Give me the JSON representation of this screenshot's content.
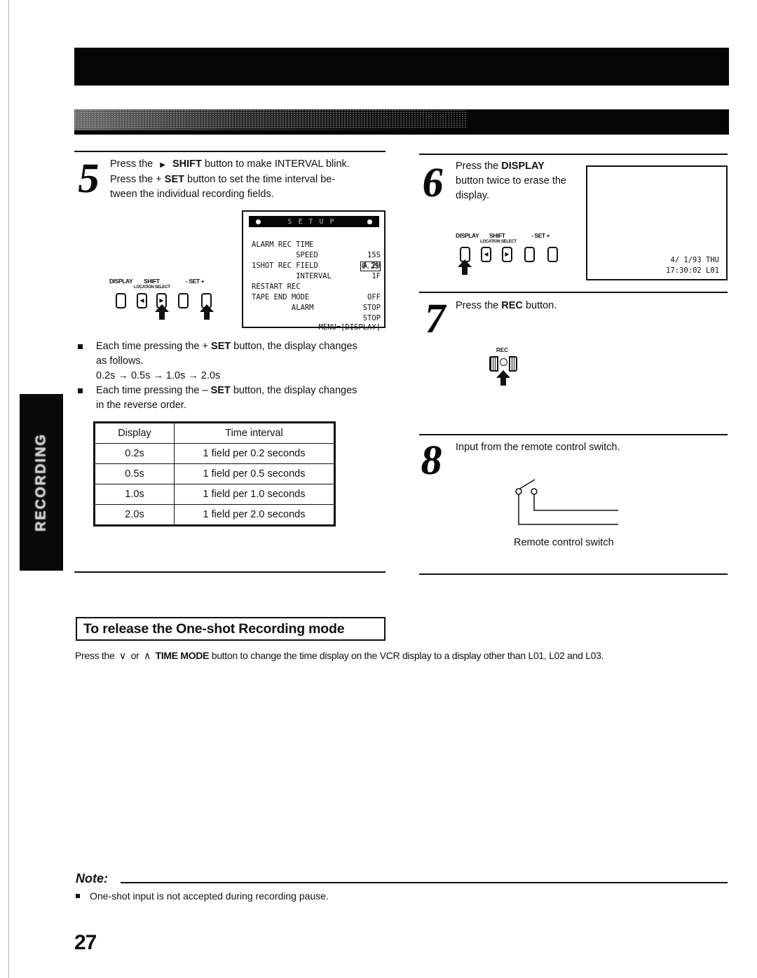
{
  "side_tab": {
    "label": "RECORDING"
  },
  "steps": {
    "step5": {
      "number": "5",
      "line1_pre": "Press the",
      "line1_icon": "▶",
      "line1_bold": "SHIFT",
      "line1_post": "button to make INTERVAL blink.",
      "line2_pre": "Press the +",
      "line2_bold": "SET",
      "line2_post": "button to set the time interval be-",
      "line3": "tween the individual recording fields."
    },
    "step6": {
      "number": "6",
      "line1_pre": "Press the",
      "line1_bold": "DISPLAY",
      "line2": "button twice to erase the",
      "line3": "display."
    },
    "step7": {
      "number": "7",
      "text_pre": "Press the",
      "text_bold": "REC",
      "text_post": "button."
    },
    "step8": {
      "number": "8",
      "text": "Input from the remote control switch.",
      "caption": "Remote control switch"
    }
  },
  "osd_menu": {
    "title": "SETUP",
    "rows": [
      {
        "label": "ALARM REC TIME",
        "value": "15S"
      },
      {
        "label": "          SPEED",
        "value": "A 2H"
      },
      {
        "label": "1SHOT REC FIELD",
        "value": "1F"
      },
      {
        "label": "          INTERVAL",
        "value": "0.2S",
        "highlighted": true
      },
      {
        "label": "RESTART REC",
        "value": "OFF"
      },
      {
        "label": "TAPE END MODE",
        "value": "STOP"
      },
      {
        "label": "         ALARM",
        "value": "STOP"
      }
    ],
    "footer": "MENU=[DISPLAY]"
  },
  "button_panel": {
    "display_label": "DISPLAY",
    "shift_label": "SHIFT",
    "set_label": "- SET +",
    "location_select_label": "LOCATION SELECT",
    "left_glyph": "◀",
    "right_glyph": "▶"
  },
  "bullets": [
    {
      "pre": "Each time pressing the +",
      "bold": "SET",
      "post": "button, the display changes",
      "line2": "as follows.",
      "line3": "0.2s → 0.5s → 1.0s → 2.0s"
    },
    {
      "pre": "Each time pressing the –",
      "bold": "SET",
      "post": "button, the display changes",
      "line2": "in the reverse order."
    }
  ],
  "interval_table": {
    "headers": [
      "Display",
      "Time interval"
    ],
    "rows": [
      [
        "0.2s",
        "1 field per 0.2 seconds"
      ],
      [
        "0.5s",
        "1 field per 0.5 seconds"
      ],
      [
        "1.0s",
        "1 field per 1.0 seconds"
      ],
      [
        "2.0s",
        "1 field per 2.0 seconds"
      ]
    ]
  },
  "tv_screen": {
    "date_line": "4/ 1/93 THU",
    "time_line": "17:30:02 L01"
  },
  "rec_button": {
    "label": "REC"
  },
  "release_section": {
    "title": "To release the One-shot Recording mode",
    "body_pre": "Press the",
    "down_icon": "∨",
    "or": "or",
    "up_icon": "∧",
    "body_bold": "TIME MODE",
    "body_post": "button to change the time display on the VCR display to a display other than L01, L02 and L03."
  },
  "note": {
    "label": "Note:",
    "items": [
      "One-shot input is not accepted during recording pause."
    ]
  },
  "page_number": "27"
}
